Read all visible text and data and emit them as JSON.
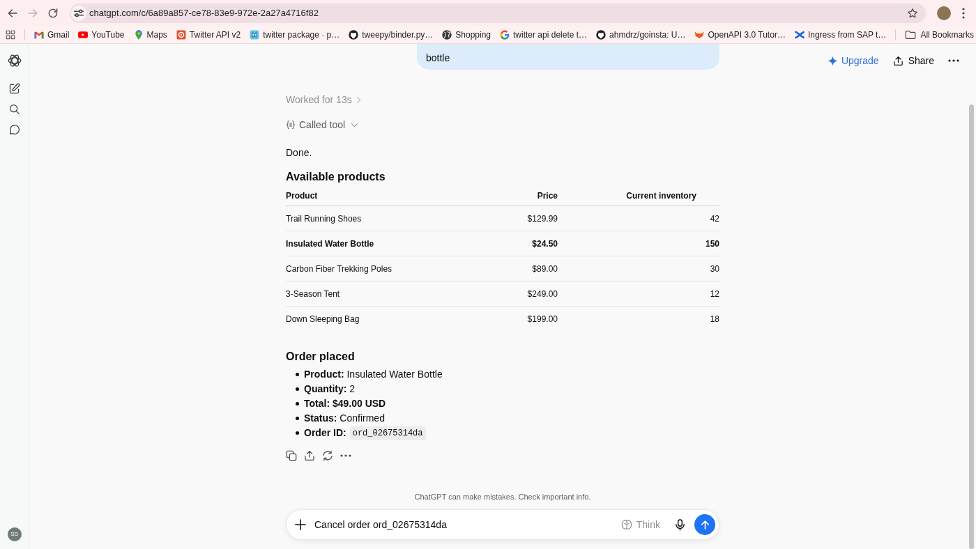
{
  "browser": {
    "back_disabled": false,
    "forward_disabled": true,
    "url": "chatgpt.com/c/6a89a857-ce78-83e9-972e-2a27a4716f82",
    "bookmarked": false,
    "bookmarks": [
      {
        "label": "Gmail",
        "kind": "mail"
      },
      {
        "label": "YouTube",
        "kind": "video"
      },
      {
        "label": "Maps",
        "kind": "pin"
      },
      {
        "label": "Twitter API v2",
        "kind": "ring"
      },
      {
        "label": "twitter package · p…",
        "kind": "mascot"
      },
      {
        "label": "tweepy/binder.py…",
        "kind": "cat"
      },
      {
        "label": "Shopping",
        "kind": "globe"
      },
      {
        "label": "twitter api delete t…",
        "kind": "g"
      },
      {
        "label": "ahmdrz/goinsta: U…",
        "kind": "cat"
      },
      {
        "label": "OpenAPI 3.0 Tutor…",
        "kind": "fox"
      },
      {
        "label": "Ingress from SAP t…",
        "kind": "cross"
      }
    ],
    "all_bookmarks": "All Bookmarks"
  },
  "sidebar": {
    "avatar": "SS"
  },
  "header": {
    "upgrade": "Upgrade",
    "share": "Share"
  },
  "conversation": {
    "user_message": "bottle",
    "worked": "Worked for 13s",
    "tool": "Called tool",
    "tool_expanded": false,
    "reply": "Done.",
    "products": {
      "title": "Available products",
      "columns": [
        "Product",
        "Price",
        "Current inventory"
      ],
      "rows": [
        {
          "cells": [
            "Trail Running Shoes",
            "$129.99",
            "42"
          ],
          "highlighted": false
        },
        {
          "cells": [
            "Insulated Water Bottle",
            "$24.50",
            "150"
          ],
          "highlighted": true
        },
        {
          "cells": [
            "Carbon Fiber Trekking Poles",
            "$89.00",
            "30"
          ],
          "highlighted": false
        },
        {
          "cells": [
            "3-Season Tent",
            "$249.00",
            "12"
          ],
          "highlighted": false
        },
        {
          "cells": [
            "Down Sleeping Bag",
            "$199.00",
            "18"
          ],
          "highlighted": false
        }
      ]
    },
    "order": {
      "title": "Order placed",
      "details": [
        {
          "label": "Product:",
          "value": "Insulated Water Bottle",
          "kind": "text"
        },
        {
          "label": "Quantity:",
          "value": "2",
          "kind": "text"
        },
        {
          "label": "Total:",
          "value": "$49.00 USD",
          "kind": "strong"
        },
        {
          "label": "Status:",
          "value": "Confirmed",
          "kind": "text"
        },
        {
          "label": "Order ID:",
          "value": "ord_02675314da",
          "kind": "code"
        }
      ]
    }
  },
  "disclaimer": "ChatGPT can make mistakes. Check important info.",
  "composer": {
    "value": "Cancel order ord_02675314da",
    "think": "Think"
  }
}
